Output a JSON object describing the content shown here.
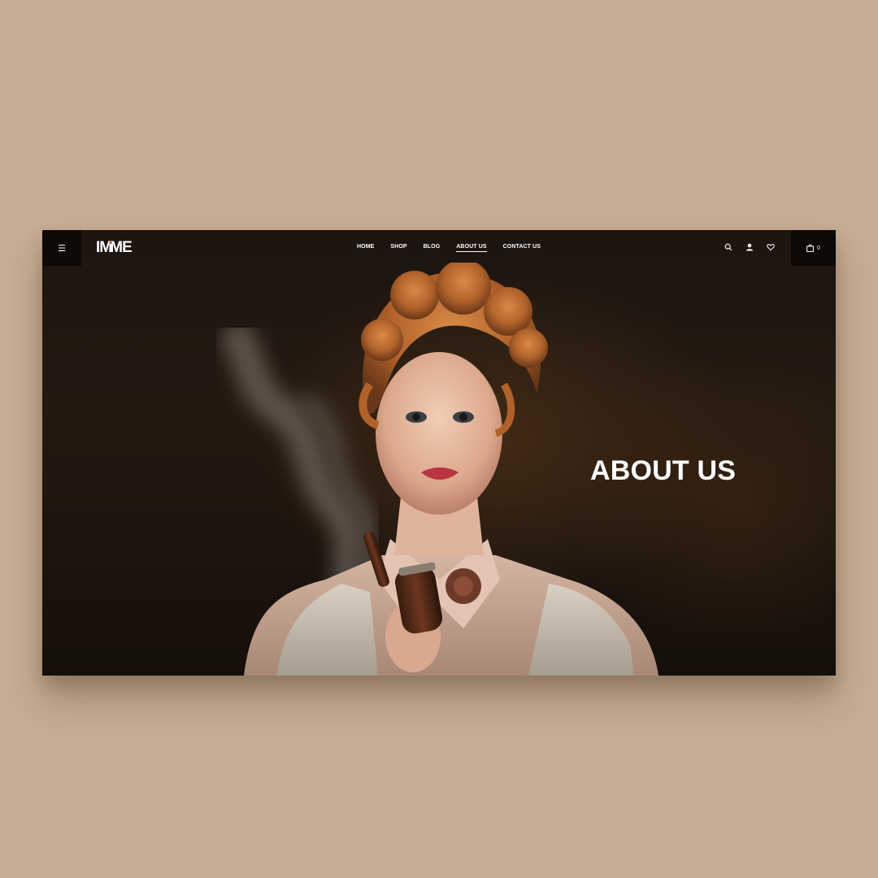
{
  "brand": {
    "logo_left": "IM",
    "logo_right": "ME"
  },
  "nav": {
    "items": [
      {
        "label": "HOME"
      },
      {
        "label": "SHOP"
      },
      {
        "label": "BLOG"
      },
      {
        "label": "ABOUT US"
      },
      {
        "label": "CONTACT US"
      }
    ],
    "active": "ABOUT US"
  },
  "header_icons": [
    "menu-icon",
    "search-icon",
    "user-icon",
    "heart-icon",
    "shopping-bag-icon"
  ],
  "cart": {
    "count": "0"
  },
  "hero": {
    "title": "ABOUT US"
  },
  "colors": {
    "page_background": "#c7ad93",
    "hero_background": "#1e160f",
    "accent": "#e0242f",
    "text": "#ffffff"
  }
}
